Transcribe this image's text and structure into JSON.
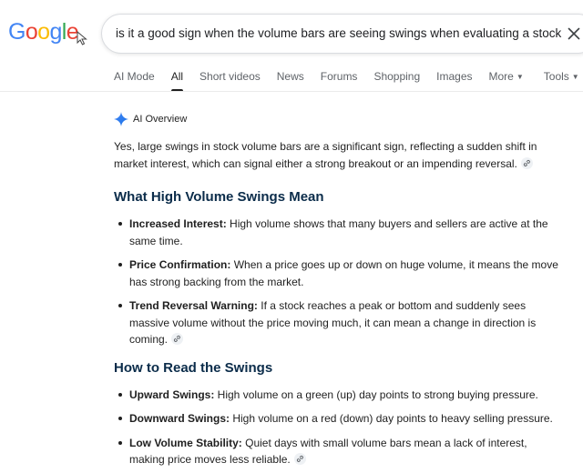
{
  "logo": {
    "letters": [
      "G",
      "o",
      "o",
      "g",
      "l",
      "e"
    ],
    "colors": [
      "#4285F4",
      "#EA4335",
      "#FBBC05",
      "#4285F4",
      "#34A853",
      "#EA4335"
    ]
  },
  "search": {
    "query": "is it a good sign when the volume bars are seeing swings when evaluating a stock"
  },
  "tabs": [
    {
      "label": "AI Mode"
    },
    {
      "label": "All",
      "active": true
    },
    {
      "label": "Short videos"
    },
    {
      "label": "News"
    },
    {
      "label": "Forums"
    },
    {
      "label": "Shopping"
    },
    {
      "label": "Images"
    },
    {
      "label": "More"
    },
    {
      "label": "Tools"
    }
  ],
  "ai_overview": {
    "label": "AI Overview",
    "intro": "Yes, large swings in stock volume bars are a significant sign, reflecting a sudden shift in market interest, which can signal either a strong breakout or an impending reversal.",
    "section1": {
      "heading": "What High Volume Swings Mean",
      "items": [
        {
          "bold": "Increased Interest:",
          "text": " High volume shows that many buyers and sellers are active at the same time."
        },
        {
          "bold": "Price Confirmation:",
          "text": " When a price goes up or down on huge volume, it means the move has strong backing from the market."
        },
        {
          "bold": "Trend Reversal Warning:",
          "text": " If a stock reaches a peak or bottom and suddenly sees massive volume without the price moving much, it can mean a change in direction is coming."
        }
      ]
    },
    "section2": {
      "heading": "How to Read the Swings",
      "items": [
        {
          "bold": "Upward Swings:",
          "text": " High volume on a green (up) day points to strong buying pressure."
        },
        {
          "bold": "Downward Swings:",
          "text": " High volume on a red (down) day points to heavy selling pressure."
        },
        {
          "bold": "Low Volume Stability:",
          "text": " Quiet days with small volume bars mean a lack of interest, making price moves less reliable."
        }
      ]
    }
  }
}
